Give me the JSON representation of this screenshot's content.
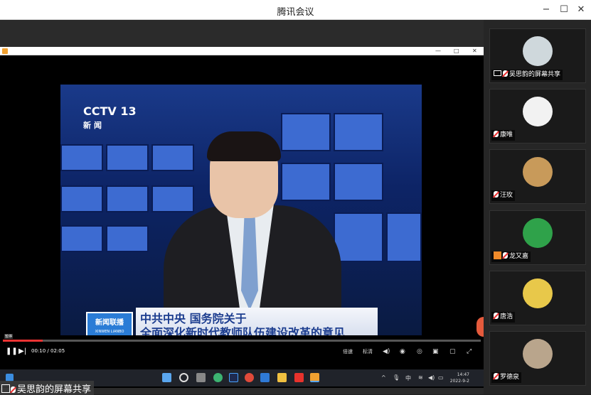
{
  "window": {
    "title": "腾讯会议",
    "minimize": "−",
    "maximize": "☐",
    "close": "✕"
  },
  "shared_screen": {
    "inner_window_buttons": {
      "minimize": "—",
      "maximize": "□",
      "close": "✕"
    },
    "video": {
      "channel_logo": "CCTV 13",
      "channel_sub": "新闻",
      "program_logo": "新闻联播",
      "program_logo_sub": "XINWEN LIANBO",
      "headline_line1": "中共中央  国务院关于",
      "headline_line2": "全面深化新时代教师队伍建设改革的意见"
    },
    "player": {
      "progress_fraction": 0.083,
      "current_time": "00:10",
      "duration": "02:05",
      "time_separator": " / ",
      "hover_tag": "暂停",
      "quality_label": "标清",
      "speed_label": "倍速",
      "play_icon": "pause-icon",
      "next_icon": "next-icon"
    },
    "taskbar": {
      "ime": "中",
      "clock_time": "14:47",
      "clock_date": "2022-9-2",
      "sys_up_arrow": "^"
    },
    "sharer_tag": "吴思韵的屏幕共享"
  },
  "participants": [
    {
      "name": "吴思韵的屏幕共享",
      "muted": true,
      "sharing": true,
      "avatar_color": "#cfd8dc"
    },
    {
      "name": "康唯",
      "muted": true,
      "avatar_color": "#f2f2f2"
    },
    {
      "name": "汪玫",
      "muted": true,
      "avatar_color": "#c89a5a"
    },
    {
      "name": "龙又嘉",
      "muted": true,
      "host": true,
      "avatar_color": "#2fa24a"
    },
    {
      "name": "唐浩",
      "muted": true,
      "avatar_color": "#e8c84a"
    },
    {
      "name": "罗德泉",
      "muted": true,
      "avatar_color": "#b9a58c"
    }
  ],
  "colors": {
    "accent_red": "#ee3333",
    "host_orange": "#f08a2a",
    "sidebar_bg": "#262626"
  }
}
